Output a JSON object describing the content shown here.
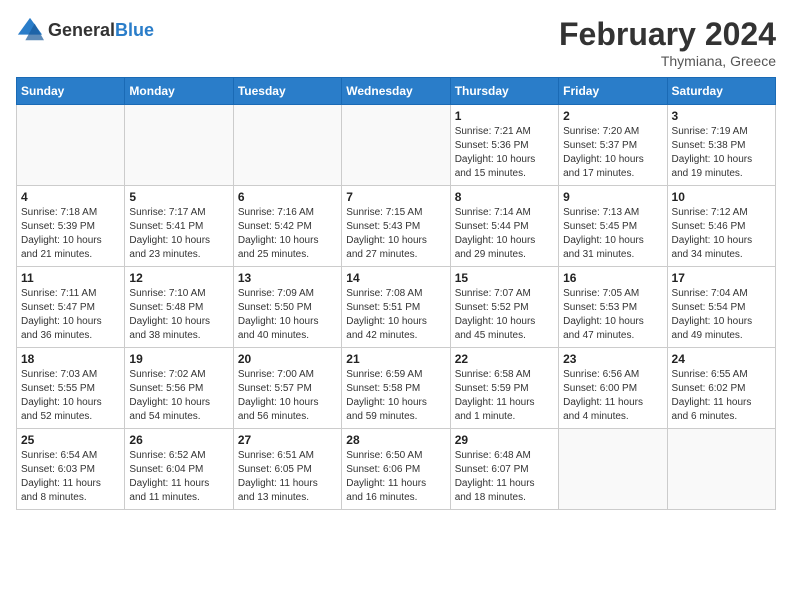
{
  "logo": {
    "general": "General",
    "blue": "Blue"
  },
  "header": {
    "month": "February 2024",
    "location": "Thymiana, Greece"
  },
  "days_of_week": [
    "Sunday",
    "Monday",
    "Tuesday",
    "Wednesday",
    "Thursday",
    "Friday",
    "Saturday"
  ],
  "weeks": [
    [
      {
        "day": "",
        "info": ""
      },
      {
        "day": "",
        "info": ""
      },
      {
        "day": "",
        "info": ""
      },
      {
        "day": "",
        "info": ""
      },
      {
        "day": "1",
        "info": "Sunrise: 7:21 AM\nSunset: 5:36 PM\nDaylight: 10 hours\nand 15 minutes."
      },
      {
        "day": "2",
        "info": "Sunrise: 7:20 AM\nSunset: 5:37 PM\nDaylight: 10 hours\nand 17 minutes."
      },
      {
        "day": "3",
        "info": "Sunrise: 7:19 AM\nSunset: 5:38 PM\nDaylight: 10 hours\nand 19 minutes."
      }
    ],
    [
      {
        "day": "4",
        "info": "Sunrise: 7:18 AM\nSunset: 5:39 PM\nDaylight: 10 hours\nand 21 minutes."
      },
      {
        "day": "5",
        "info": "Sunrise: 7:17 AM\nSunset: 5:41 PM\nDaylight: 10 hours\nand 23 minutes."
      },
      {
        "day": "6",
        "info": "Sunrise: 7:16 AM\nSunset: 5:42 PM\nDaylight: 10 hours\nand 25 minutes."
      },
      {
        "day": "7",
        "info": "Sunrise: 7:15 AM\nSunset: 5:43 PM\nDaylight: 10 hours\nand 27 minutes."
      },
      {
        "day": "8",
        "info": "Sunrise: 7:14 AM\nSunset: 5:44 PM\nDaylight: 10 hours\nand 29 minutes."
      },
      {
        "day": "9",
        "info": "Sunrise: 7:13 AM\nSunset: 5:45 PM\nDaylight: 10 hours\nand 31 minutes."
      },
      {
        "day": "10",
        "info": "Sunrise: 7:12 AM\nSunset: 5:46 PM\nDaylight: 10 hours\nand 34 minutes."
      }
    ],
    [
      {
        "day": "11",
        "info": "Sunrise: 7:11 AM\nSunset: 5:47 PM\nDaylight: 10 hours\nand 36 minutes."
      },
      {
        "day": "12",
        "info": "Sunrise: 7:10 AM\nSunset: 5:48 PM\nDaylight: 10 hours\nand 38 minutes."
      },
      {
        "day": "13",
        "info": "Sunrise: 7:09 AM\nSunset: 5:50 PM\nDaylight: 10 hours\nand 40 minutes."
      },
      {
        "day": "14",
        "info": "Sunrise: 7:08 AM\nSunset: 5:51 PM\nDaylight: 10 hours\nand 42 minutes."
      },
      {
        "day": "15",
        "info": "Sunrise: 7:07 AM\nSunset: 5:52 PM\nDaylight: 10 hours\nand 45 minutes."
      },
      {
        "day": "16",
        "info": "Sunrise: 7:05 AM\nSunset: 5:53 PM\nDaylight: 10 hours\nand 47 minutes."
      },
      {
        "day": "17",
        "info": "Sunrise: 7:04 AM\nSunset: 5:54 PM\nDaylight: 10 hours\nand 49 minutes."
      }
    ],
    [
      {
        "day": "18",
        "info": "Sunrise: 7:03 AM\nSunset: 5:55 PM\nDaylight: 10 hours\nand 52 minutes."
      },
      {
        "day": "19",
        "info": "Sunrise: 7:02 AM\nSunset: 5:56 PM\nDaylight: 10 hours\nand 54 minutes."
      },
      {
        "day": "20",
        "info": "Sunrise: 7:00 AM\nSunset: 5:57 PM\nDaylight: 10 hours\nand 56 minutes."
      },
      {
        "day": "21",
        "info": "Sunrise: 6:59 AM\nSunset: 5:58 PM\nDaylight: 10 hours\nand 59 minutes."
      },
      {
        "day": "22",
        "info": "Sunrise: 6:58 AM\nSunset: 5:59 PM\nDaylight: 11 hours\nand 1 minute."
      },
      {
        "day": "23",
        "info": "Sunrise: 6:56 AM\nSunset: 6:00 PM\nDaylight: 11 hours\nand 4 minutes."
      },
      {
        "day": "24",
        "info": "Sunrise: 6:55 AM\nSunset: 6:02 PM\nDaylight: 11 hours\nand 6 minutes."
      }
    ],
    [
      {
        "day": "25",
        "info": "Sunrise: 6:54 AM\nSunset: 6:03 PM\nDaylight: 11 hours\nand 8 minutes."
      },
      {
        "day": "26",
        "info": "Sunrise: 6:52 AM\nSunset: 6:04 PM\nDaylight: 11 hours\nand 11 minutes."
      },
      {
        "day": "27",
        "info": "Sunrise: 6:51 AM\nSunset: 6:05 PM\nDaylight: 11 hours\nand 13 minutes."
      },
      {
        "day": "28",
        "info": "Sunrise: 6:50 AM\nSunset: 6:06 PM\nDaylight: 11 hours\nand 16 minutes."
      },
      {
        "day": "29",
        "info": "Sunrise: 6:48 AM\nSunset: 6:07 PM\nDaylight: 11 hours\nand 18 minutes."
      },
      {
        "day": "",
        "info": ""
      },
      {
        "day": "",
        "info": ""
      }
    ]
  ]
}
